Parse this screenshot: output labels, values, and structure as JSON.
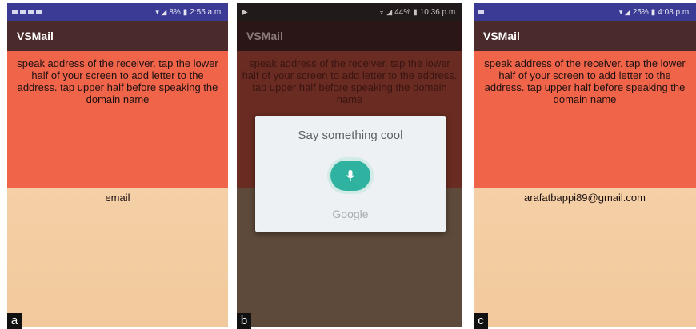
{
  "panels": [
    {
      "label": "a",
      "status": {
        "battery": "8%",
        "time": "2:55 a.m."
      },
      "app_title": "VSMail",
      "instruction": "speak address of the receiver. tap the lower half of your screen to add letter to the address. tap upper half before speaking the domain name",
      "field_text": "email"
    },
    {
      "label": "b",
      "status": {
        "battery": "44%",
        "time": "10:36 p.m."
      },
      "app_title": "VSMail",
      "instruction": "speak address of the receiver. tap the lower half of your screen to add letter to the address. tap upper half before speaking the domain name",
      "dialog": {
        "prompt": "Say something cool",
        "brand": "Google"
      }
    },
    {
      "label": "c",
      "status": {
        "battery": "25%",
        "time": "4:08 p.m."
      },
      "app_title": "VSMail",
      "instruction": "speak address of the receiver. tap the lower half of your screen to add letter to the address. tap upper half before speaking the domain name",
      "field_text": "arafatbappi89@gmail.com"
    }
  ],
  "colors": {
    "status_bar": "#3b3b96",
    "app_bar": "#4a2a2a",
    "top_half": "#f0654a",
    "bottom_half": "#f5cfa6",
    "mic_accent": "#2fb3a0"
  }
}
